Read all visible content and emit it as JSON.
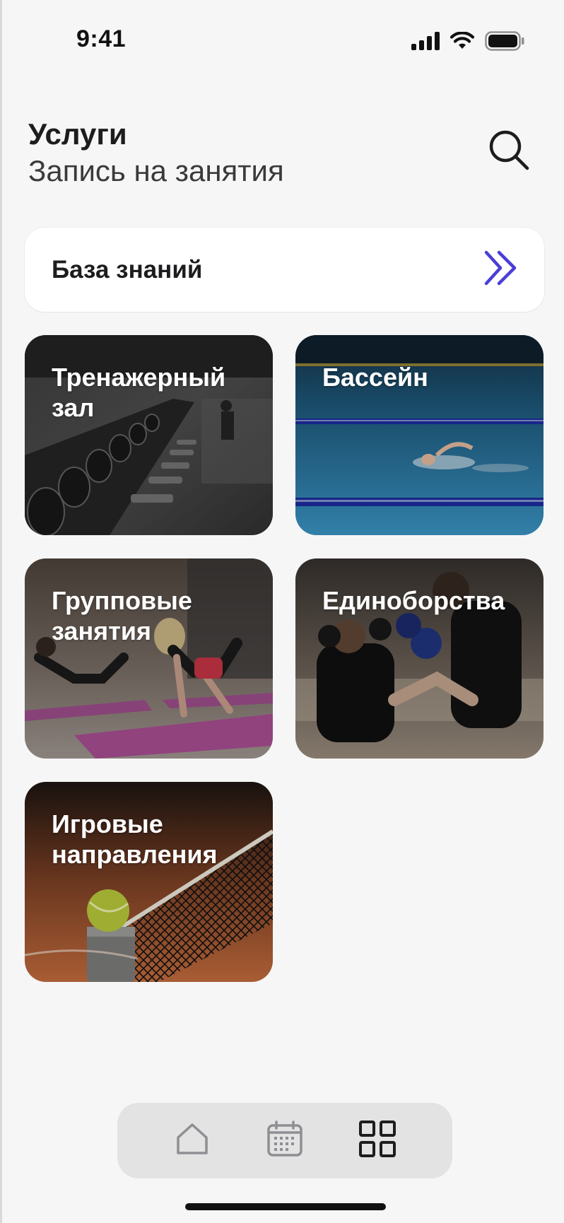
{
  "status_bar": {
    "time": "9:41"
  },
  "header": {
    "title": "Услуги",
    "subtitle": "Запись на занятия"
  },
  "knowledge_base": {
    "label": "База знаний"
  },
  "tiles": [
    {
      "label": "Тренажерный зал",
      "line1": "Тренажерный",
      "line2": "зал"
    },
    {
      "label": "Бассейн",
      "line1": "Бассейн",
      "line2": ""
    },
    {
      "label": "Групповые занятия",
      "line1": "Групповые",
      "line2": "занятия"
    },
    {
      "label": "Единоборства",
      "line1": "Единоборства",
      "line2": ""
    },
    {
      "label": "Игровые направления",
      "line1": "Игровые",
      "line2": "направления"
    }
  ],
  "tab_bar": {
    "items": [
      {
        "icon": "home-icon",
        "active": false
      },
      {
        "icon": "calendar-icon",
        "active": false
      },
      {
        "icon": "grid-icon",
        "active": true
      }
    ]
  },
  "colors": {
    "background": "#f6f6f6",
    "accent": "#4a3ed6",
    "card": "#ffffff",
    "tab_bar": "#e3e3e3"
  }
}
